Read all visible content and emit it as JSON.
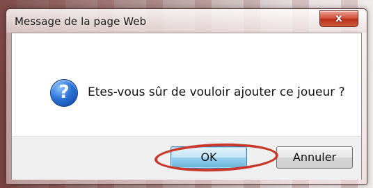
{
  "dialog": {
    "title": "Message de la page Web",
    "close_label": "x",
    "message": "Etes-vous sûr de vouloir ajouter ce joueur ?",
    "icon": "question-icon",
    "buttons": {
      "ok_label": "OK",
      "cancel_label": "Annuler"
    },
    "highlight_color": "#c8392b"
  }
}
